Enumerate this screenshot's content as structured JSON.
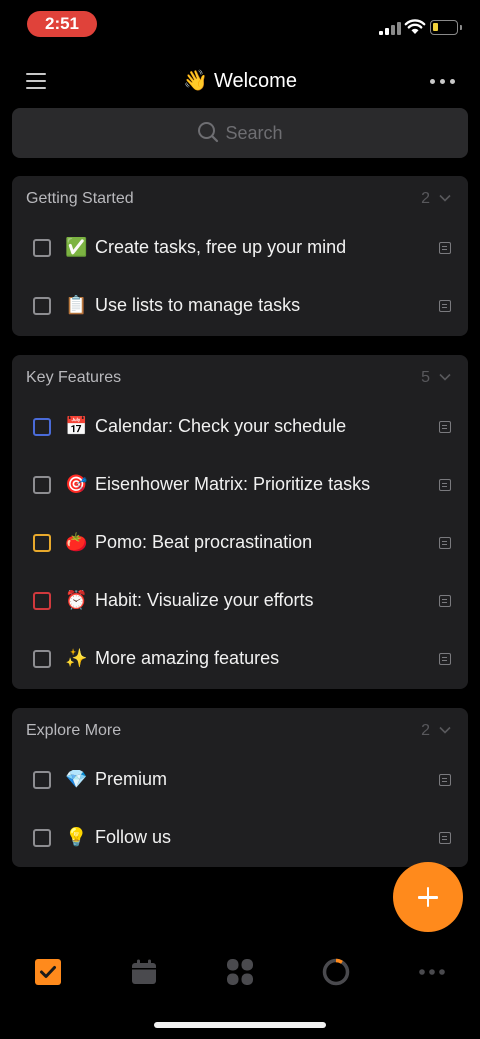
{
  "status": {
    "time": "2:51"
  },
  "header": {
    "emoji": "👋",
    "title": "Welcome"
  },
  "search": {
    "placeholder": "Search"
  },
  "sections": [
    {
      "title": "Getting Started",
      "count": "2",
      "tasks": [
        {
          "emoji": "✅",
          "text": "Create tasks, free up your mind",
          "checkbox_color": "#8d8d91"
        },
        {
          "emoji": "📋",
          "text": "Use lists to manage tasks",
          "checkbox_color": "#8d8d91"
        }
      ]
    },
    {
      "title": "Key Features",
      "count": "5",
      "tasks": [
        {
          "emoji": "📅",
          "text": "Calendar: Check your schedule",
          "checkbox_color": "#4a6bd8"
        },
        {
          "emoji": "🎯",
          "text": "Eisenhower Matrix: Prioritize tasks",
          "checkbox_color": "#8d8d91"
        },
        {
          "emoji": "🍅",
          "text": "Pomo: Beat procrastination",
          "checkbox_color": "#e8a92c"
        },
        {
          "emoji": "⏰",
          "text": "Habit: Visualize your efforts",
          "checkbox_color": "#d0393d"
        },
        {
          "emoji": "✨",
          "text": "More amazing features",
          "checkbox_color": "#8d8d91"
        }
      ]
    },
    {
      "title": "Explore More",
      "count": "2",
      "tasks": [
        {
          "emoji": "💎",
          "text": "Premium",
          "checkbox_color": "#8d8d91"
        },
        {
          "emoji": "💡",
          "text": "Follow us",
          "checkbox_color": "#8d8d91"
        }
      ]
    }
  ],
  "tabbar": {
    "tabs": [
      "tasks-icon",
      "calendar-icon",
      "matrix-icon",
      "pomo-icon",
      "more-icon"
    ],
    "active_color": "#ff8a1c",
    "inactive_color": "#4a4a4e"
  },
  "colors": {
    "accent": "#ff8a1c",
    "card_bg": "#1f1f21",
    "search_bg": "#2a2a2c"
  }
}
